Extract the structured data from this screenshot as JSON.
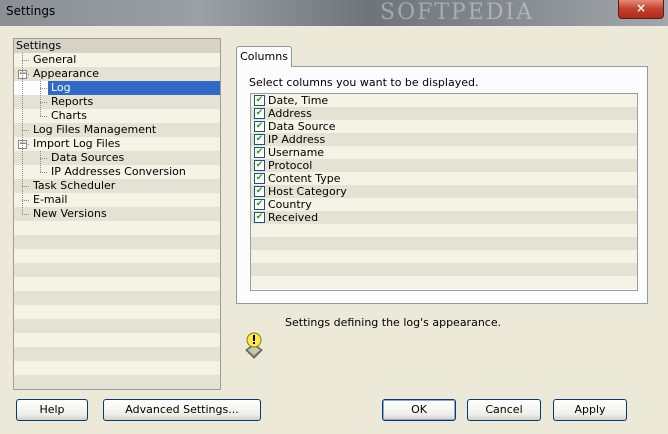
{
  "window": {
    "title": "Settings",
    "watermark": "SOFTPEDIA",
    "close_label": "×"
  },
  "tree": {
    "items": [
      {
        "label": "Settings",
        "level": 0
      },
      {
        "label": "General",
        "level": 1
      },
      {
        "label": "Appearance",
        "level": 1,
        "expander": "−"
      },
      {
        "label": "Log",
        "level": 2,
        "selected": true
      },
      {
        "label": "Reports",
        "level": 2
      },
      {
        "label": "Charts",
        "level": 2
      },
      {
        "label": "Log Files Management",
        "level": 1
      },
      {
        "label": "Import Log Files",
        "level": 1,
        "expander": "−"
      },
      {
        "label": "Data Sources",
        "level": 2
      },
      {
        "label": "IP Addresses Conversion",
        "level": 2
      },
      {
        "label": "Task Scheduler",
        "level": 1
      },
      {
        "label": "E-mail",
        "level": 1
      },
      {
        "label": "New Versions",
        "level": 1
      }
    ]
  },
  "tab": {
    "label": "Columns"
  },
  "panel": {
    "description": "Select columns you want to be displayed.",
    "columns": [
      {
        "label": "Date, Time",
        "checked": true
      },
      {
        "label": "Address",
        "checked": true
      },
      {
        "label": "Data Source",
        "checked": true
      },
      {
        "label": "IP Address",
        "checked": true
      },
      {
        "label": "Username",
        "checked": true
      },
      {
        "label": "Protocol",
        "checked": true
      },
      {
        "label": "Content Type",
        "checked": true
      },
      {
        "label": "Host Category",
        "checked": true
      },
      {
        "label": "Country",
        "checked": true
      },
      {
        "label": "Received",
        "checked": true
      }
    ]
  },
  "info": {
    "text": "Settings defining the log's appearance."
  },
  "buttons": {
    "help": "Help",
    "advanced": "Advanced Settings...",
    "ok": "OK",
    "cancel": "Cancel",
    "apply": "Apply"
  },
  "colors": {
    "selection": "#3169c6",
    "row_light": "#f4f3e6",
    "row_dark": "#e4e3d3",
    "check": "#21a121"
  }
}
